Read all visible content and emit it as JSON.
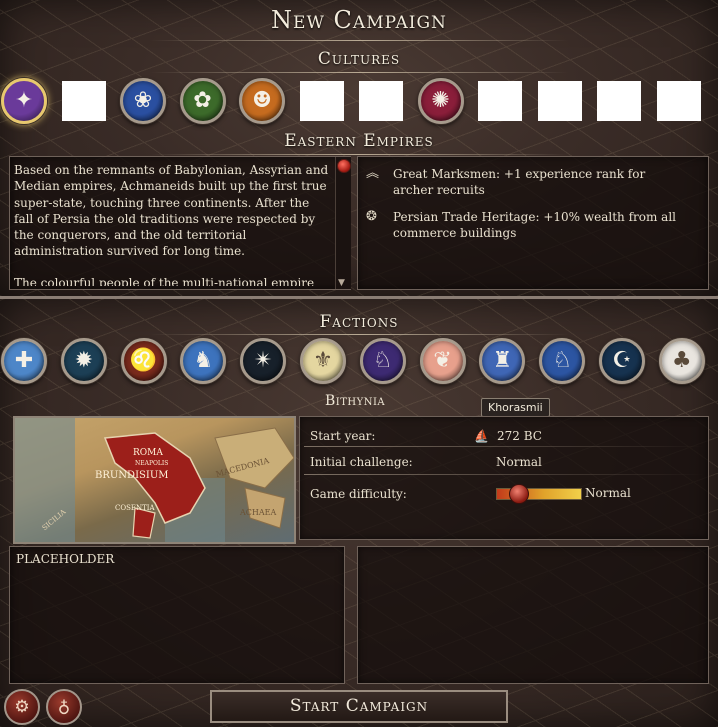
{
  "header": {
    "title": "New Campaign"
  },
  "cultures": {
    "title": "Cultures",
    "items": [
      {
        "icon": "purple-eagle-emblem-icon",
        "color": "#6a3a9a",
        "glyph": "✦",
        "selected": true
      },
      {
        "icon": "blank-emblem",
        "blank": true
      },
      {
        "icon": "blue-dragon-emblem-icon",
        "color": "#2a4fa0",
        "glyph": "❀"
      },
      {
        "icon": "green-boar-emblem-icon",
        "color": "#3c6a2a",
        "glyph": "✿"
      },
      {
        "icon": "orange-head-emblem-icon",
        "color": "#c56b1f",
        "glyph": "☻"
      },
      {
        "icon": "blank-emblem",
        "blank": true
      },
      {
        "icon": "blank-emblem",
        "blank": true
      },
      {
        "icon": "crimson-triskele-emblem-icon",
        "color": "#8a1e3a",
        "glyph": "✺"
      },
      {
        "icon": "blank-emblem",
        "blank": true
      },
      {
        "icon": "blank-emblem",
        "blank": true
      },
      {
        "icon": "blank-emblem",
        "blank": true
      },
      {
        "icon": "blank-emblem",
        "blank": true
      }
    ],
    "selected_name": "Eastern Empires",
    "description": [
      "Based on the remnants of Babylonian, Assyrian and Median empires, Achmaneids built up the first true super-state, touching three continents. After the fall of Persia the old traditions were respected by the conquerors, and the old territorial administration survived for long time.",
      "The colourful people of the multi-national empire"
    ],
    "traits": [
      {
        "icon": "chevrons-up-icon",
        "text": "Great Marksmen: +1 experience rank for archer recruits"
      },
      {
        "icon": "trade-wreath-icon",
        "text": "Persian Trade Heritage: +10% wealth from all commerce buildings"
      }
    ]
  },
  "factions": {
    "title": "Factions",
    "items": [
      {
        "icon": "cross-shield-emblem-icon",
        "color": "#4d86c8",
        "glyph": "✚"
      },
      {
        "icon": "white-star-emblem-icon",
        "color": "#1c3f55",
        "glyph": "✹"
      },
      {
        "icon": "lion-head-emblem-icon",
        "color": "#7a2a1c",
        "glyph": "♌"
      },
      {
        "icon": "white-figure-emblem-icon",
        "color": "#3d73bd",
        "glyph": "♞"
      },
      {
        "icon": "golden-sun-emblem-icon",
        "color": "#17202a",
        "glyph": "✴"
      },
      {
        "icon": "winged-emblem-icon",
        "color": "#e4d6a0",
        "glyph": "⚜"
      },
      {
        "icon": "red-griffin-emblem-icon",
        "color": "#3d2a72",
        "glyph": "♘"
      },
      {
        "icon": "pink-boar-emblem-icon",
        "color": "#e7a08c",
        "glyph": "❦"
      },
      {
        "icon": "blue-city-emblem-icon",
        "color": "#3f66b5",
        "glyph": "♜"
      },
      {
        "icon": "pegasus-emblem-icon",
        "color": "#2c55a2",
        "glyph": "♘"
      },
      {
        "icon": "crescent-star-emblem-icon",
        "color": "#16324f",
        "glyph": "☪"
      },
      {
        "icon": "elephant-emblem-icon",
        "color": "#e9e5df",
        "glyph": "♣"
      }
    ],
    "selected_name": "Bithynia",
    "tooltip": "Khorasmii",
    "map_labels": [
      "ROMA",
      "NEAPOLIS",
      "BRUNDISIUM",
      "COSENTIA",
      "MACEDONIA",
      "ACHAEA",
      "SICILIA"
    ],
    "start_year_label": "Start year:",
    "start_year_value": "272 BC",
    "challenge_label": "Initial challenge:",
    "challenge_value": "Normal",
    "difficulty_label": "Game difficulty:",
    "difficulty_value": "Normal",
    "difficulty_level_fraction": 0.2,
    "placeholder": "PLACEHOLDER"
  },
  "footer": {
    "start_label": "Start Campaign",
    "left_buttons": [
      {
        "icon": "gears-icon",
        "glyph": "⚙"
      },
      {
        "icon": "goblet-icon",
        "glyph": "♁"
      }
    ]
  }
}
